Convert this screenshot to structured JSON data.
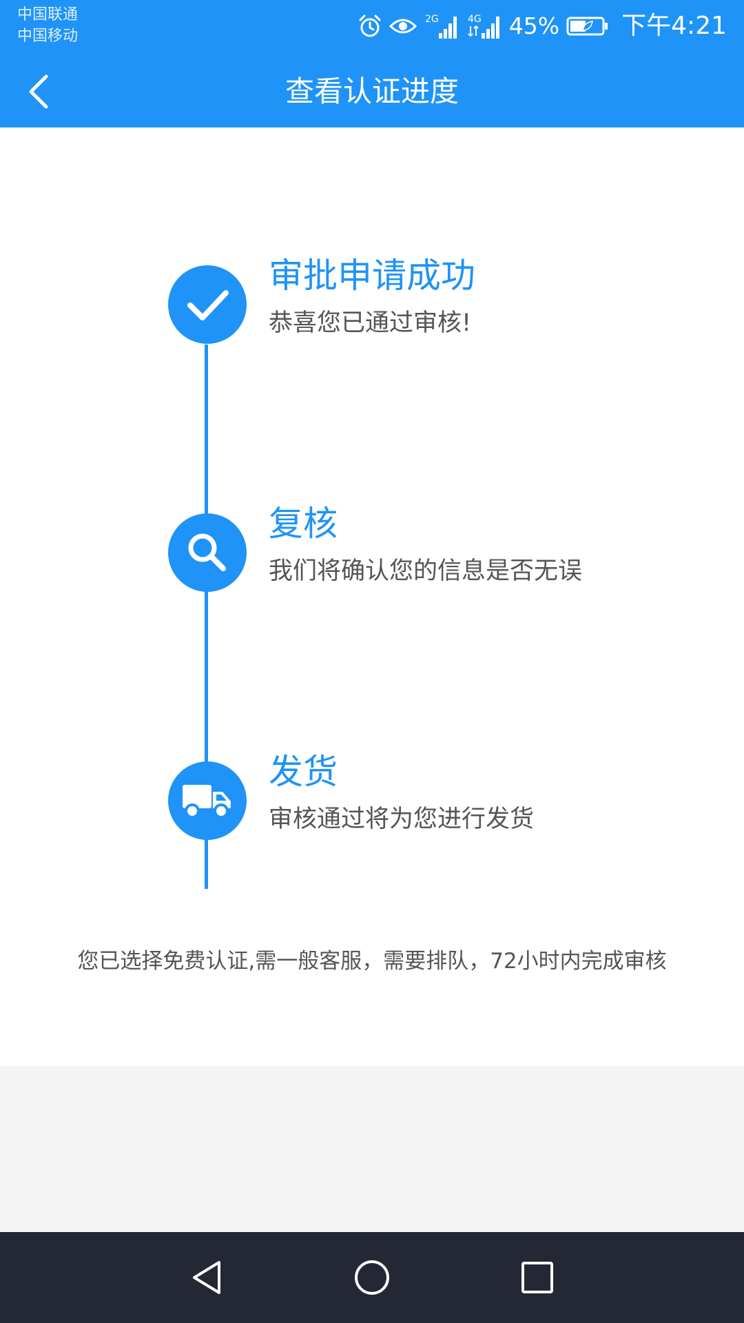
{
  "status_bar": {
    "carrier_1": "中国联通",
    "carrier_2": "中国移动",
    "signal_1_label": "2G",
    "signal_2_label": "4G",
    "battery_percent": "45%",
    "time": "下午4:21",
    "icons": [
      "alarm-icon",
      "eye-comfort-icon",
      "signal-2g-icon",
      "signal-4g-icon",
      "battery-icon"
    ]
  },
  "header": {
    "title": "查看认证进度",
    "back_icon": "chevron-left-icon",
    "background_color": "#1f93f7"
  },
  "steps": [
    {
      "title": "审批申请成功",
      "desc": "恭喜您已通过审核!",
      "icon": "checkmark-icon"
    },
    {
      "title": "复核",
      "desc": "我们将确认您的信息是否无误",
      "icon": "search-icon"
    },
    {
      "title": "发货",
      "desc": "审核通过将为您进行发货",
      "icon": "truck-icon"
    }
  ],
  "notice": "您已选择免费认证,需一般客服，需要排队，72小时内完成审核",
  "system_nav": {
    "buttons": [
      "back-triangle-icon",
      "home-circle-icon",
      "recents-square-icon"
    ]
  },
  "colors": {
    "accent": "#1f93f7",
    "text_secondary": "#555555",
    "nav_bar": "#232834",
    "page_bg": "#f4f4f4"
  }
}
